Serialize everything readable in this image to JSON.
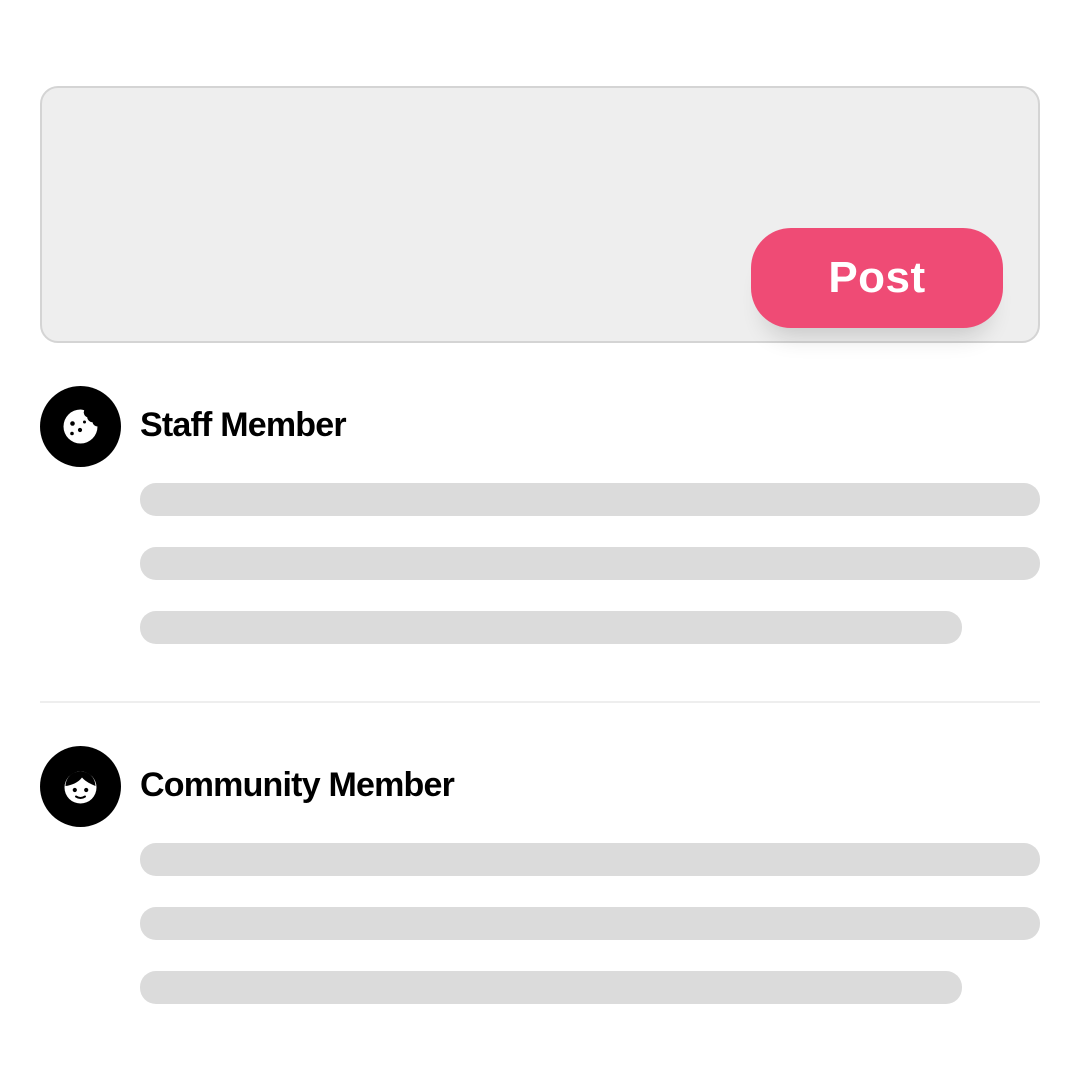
{
  "composer": {
    "input_value": "",
    "input_placeholder": "",
    "post_button_label": "Post",
    "accent_color": "#ef4b75"
  },
  "posts": [
    {
      "author": "Staff Member",
      "avatar_icon": "cookie-icon"
    },
    {
      "author": "Community Member",
      "avatar_icon": "face-icon"
    }
  ]
}
